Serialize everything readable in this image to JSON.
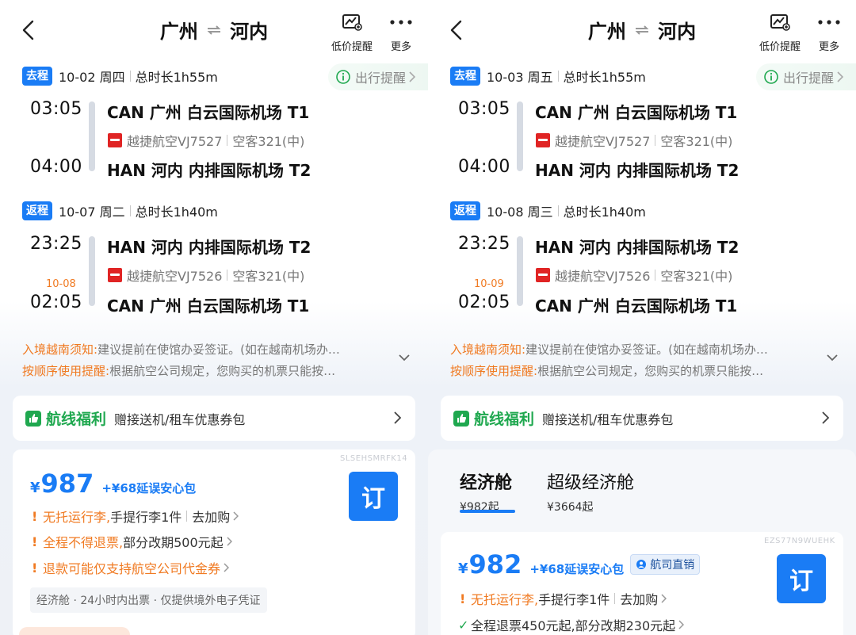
{
  "panels": [
    {
      "title_from": "广州",
      "title_to": "河内",
      "actions": {
        "price_alert": "低价提醒",
        "more": "更多"
      },
      "trip_alert": "出行提醒",
      "outbound": {
        "tag": "去程",
        "date": "10-02 周四",
        "duration": "总时长1h55m",
        "dep_time": "03:05",
        "dep_airport": "CAN  广州 白云国际机场 T1",
        "airline": "越捷航空VJ7527",
        "aircraft": "空客321(中)",
        "arr_time": "04:00",
        "arr_airport": "HAN  河内 内排国际机场 T2"
      },
      "return": {
        "tag": "返程",
        "date": "10-07 周二",
        "duration": "总时长1h40m",
        "dep_time": "23:25",
        "dep_airport": "HAN  河内 内排国际机场 T2",
        "airline": "越捷航空VJ7526",
        "aircraft": "空客321(中)",
        "next_day": "10-08",
        "arr_time": "02:05",
        "arr_airport": "CAN  广州 白云国际机场 T1"
      },
      "notices": [
        {
          "key": "入境越南须知:",
          "text": "建议提前在使馆办妥签证。(如在越南机场办…"
        },
        {
          "key": "按顺序使用提醒:",
          "text": "根据航空公司规定，您购买的机票只能按…"
        }
      ],
      "benefit": {
        "name": "航线福利",
        "desc": "赠接送机/租车优惠券包"
      },
      "fare": {
        "code": "SLSEHSMRFK14",
        "currency": "¥",
        "price": "987",
        "addon": "+¥68延误安心包",
        "book": "订",
        "rules": [
          {
            "orange": "无托运行李,",
            "normal": "手提行李1件",
            "extra": "去加购"
          },
          {
            "orange": "全程不得退票,",
            "normal": "部分改期500元起"
          },
          {
            "orange": "退款可能仅支持航空公司代金券",
            "normal": ""
          }
        ],
        "tags": "经济舱 · 24小时内出票 · 仅提供境外电子凭证"
      }
    },
    {
      "title_from": "广州",
      "title_to": "河内",
      "actions": {
        "price_alert": "低价提醒",
        "more": "更多"
      },
      "trip_alert": "出行提醒",
      "outbound": {
        "tag": "去程",
        "date": "10-03 周五",
        "duration": "总时长1h55m",
        "dep_time": "03:05",
        "dep_airport": "CAN  广州 白云国际机场 T1",
        "airline": "越捷航空VJ7527",
        "aircraft": "空客321(中)",
        "arr_time": "04:00",
        "arr_airport": "HAN  河内 内排国际机场 T2"
      },
      "return": {
        "tag": "返程",
        "date": "10-08 周三",
        "duration": "总时长1h40m",
        "dep_time": "23:25",
        "dep_airport": "HAN  河内 内排国际机场 T2",
        "airline": "越捷航空VJ7526",
        "aircraft": "空客321(中)",
        "next_day": "10-09",
        "arr_time": "02:05",
        "arr_airport": "CAN  广州 白云国际机场 T1"
      },
      "notices": [
        {
          "key": "入境越南须知:",
          "text": "建议提前在使馆办妥签证。(如在越南机场办…"
        },
        {
          "key": "按顺序使用提醒:",
          "text": "根据航空公司规定，您购买的机票只能按…"
        }
      ],
      "benefit": {
        "name": "航线福利",
        "desc": "赠接送机/租车优惠券包"
      },
      "cabins": [
        {
          "name": "经济舱",
          "price": "¥982起"
        },
        {
          "name": "超级经济舱",
          "price": "¥3664起"
        }
      ],
      "fare": {
        "code": "EZS77N9WUEHK",
        "currency": "¥",
        "price": "982",
        "addon": "+¥68延误安心包",
        "badge": "航司直销",
        "book": "订",
        "rules": [
          {
            "orange": "无托运行李,",
            "normal": "手提行李1件",
            "extra": "去加购"
          },
          {
            "orange": "",
            "normal": "全程退票450元起,部分改期230元起"
          }
        ]
      }
    }
  ]
}
